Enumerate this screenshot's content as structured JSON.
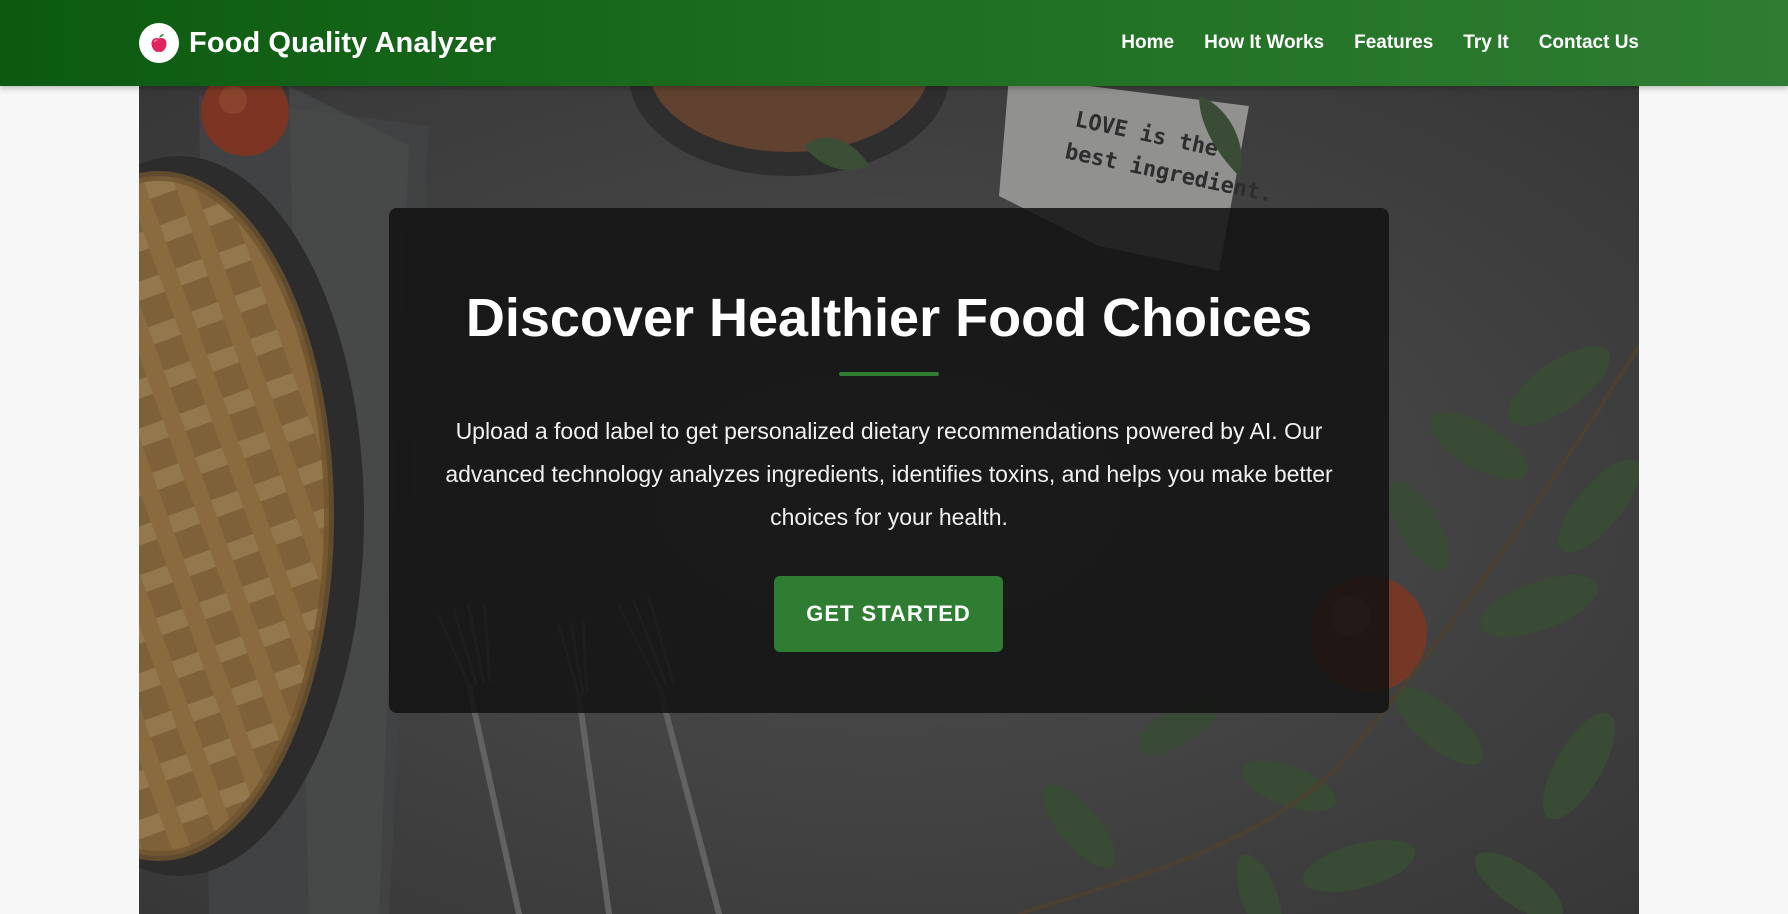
{
  "navbar": {
    "brand": {
      "title": "Food Quality Analyzer",
      "logo_icon": "apple-icon"
    },
    "links": [
      {
        "label": "Home"
      },
      {
        "label": "How It Works"
      },
      {
        "label": "Features"
      },
      {
        "label": "Try It"
      },
      {
        "label": "Contact Us"
      }
    ]
  },
  "hero": {
    "background_text": {
      "line1": "LOVE is the",
      "line2": "best ingredient."
    },
    "title": "Discover Healthier Food Choices",
    "description": "Upload a food label to get personalized dietary recommendations powered by AI. Our advanced technology analyzes ingredients, identifies toxins, and helps you make better choices for your health.",
    "cta_label": "GET STARTED"
  },
  "colors": {
    "nav_gradient_start": "#0b5a10",
    "nav_gradient_end": "#2e7d32",
    "accent": "#2e7d32",
    "card_bg": "#111111",
    "page_bg": "#f7f7f7"
  }
}
